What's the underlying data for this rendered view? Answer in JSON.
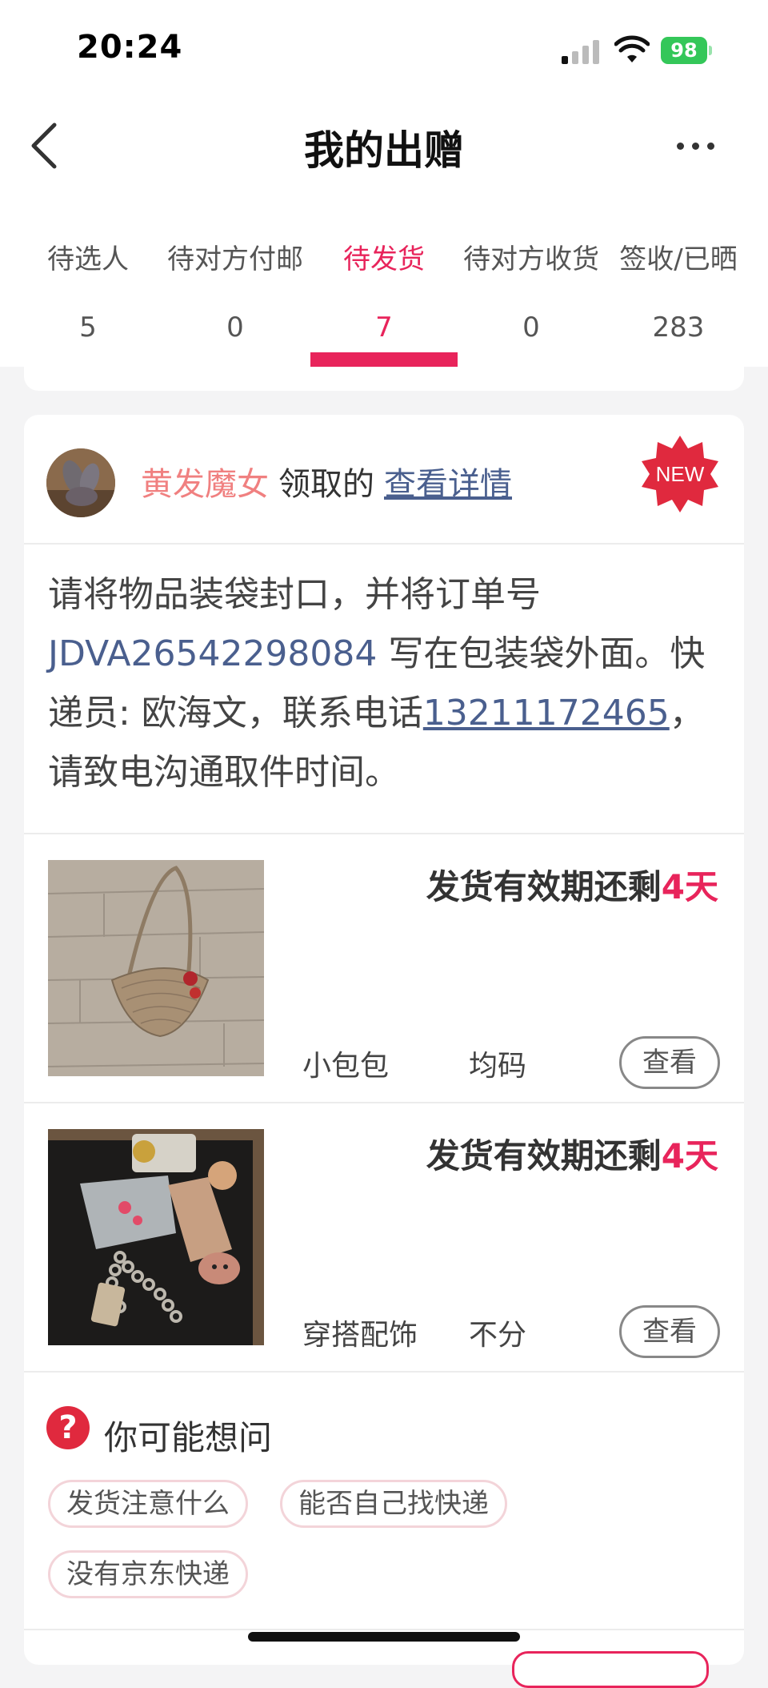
{
  "status_bar": {
    "time": "20:24",
    "battery": "98"
  },
  "header": {
    "title": "我的出赠"
  },
  "tabs": [
    {
      "label": "待选人",
      "count": "5"
    },
    {
      "label": "待对方付邮",
      "count": "0"
    },
    {
      "label": "待发货",
      "count": "7",
      "active": true
    },
    {
      "label": "待对方收货",
      "count": "0"
    },
    {
      "label": "签收/已晒",
      "count": "283"
    }
  ],
  "order": {
    "receiver_name": "黄发魔女",
    "receiver_verb": "领取的",
    "detail_link": "查看详情",
    "badge": "NEW",
    "instructions": {
      "part1": "请将物品装袋封口，并将订单号 ",
      "order_number": "JDVA26542298084",
      "part2": " 写在包装袋外面。快递员: 欧海文，联系电话",
      "phone": "13211172465",
      "part3": "，请致电沟通取件时间。"
    },
    "items": [
      {
        "deadline_prefix": "发货有效期还剩",
        "deadline_days": "4天",
        "name": "小包包",
        "size": "均码",
        "view_label": "查看"
      },
      {
        "deadline_prefix": "发货有效期还剩",
        "deadline_days": "4天",
        "name": "穿搭配饰",
        "size": "不分",
        "view_label": "查看"
      }
    ]
  },
  "faq": {
    "icon": "?",
    "title": "你可能想问",
    "chips": [
      "发货注意什么",
      "能否自己找快递",
      "没有京东快递"
    ]
  },
  "colors": {
    "accent": "#e8245b",
    "link": "#4a5f8e",
    "receiver": "#f08080"
  }
}
